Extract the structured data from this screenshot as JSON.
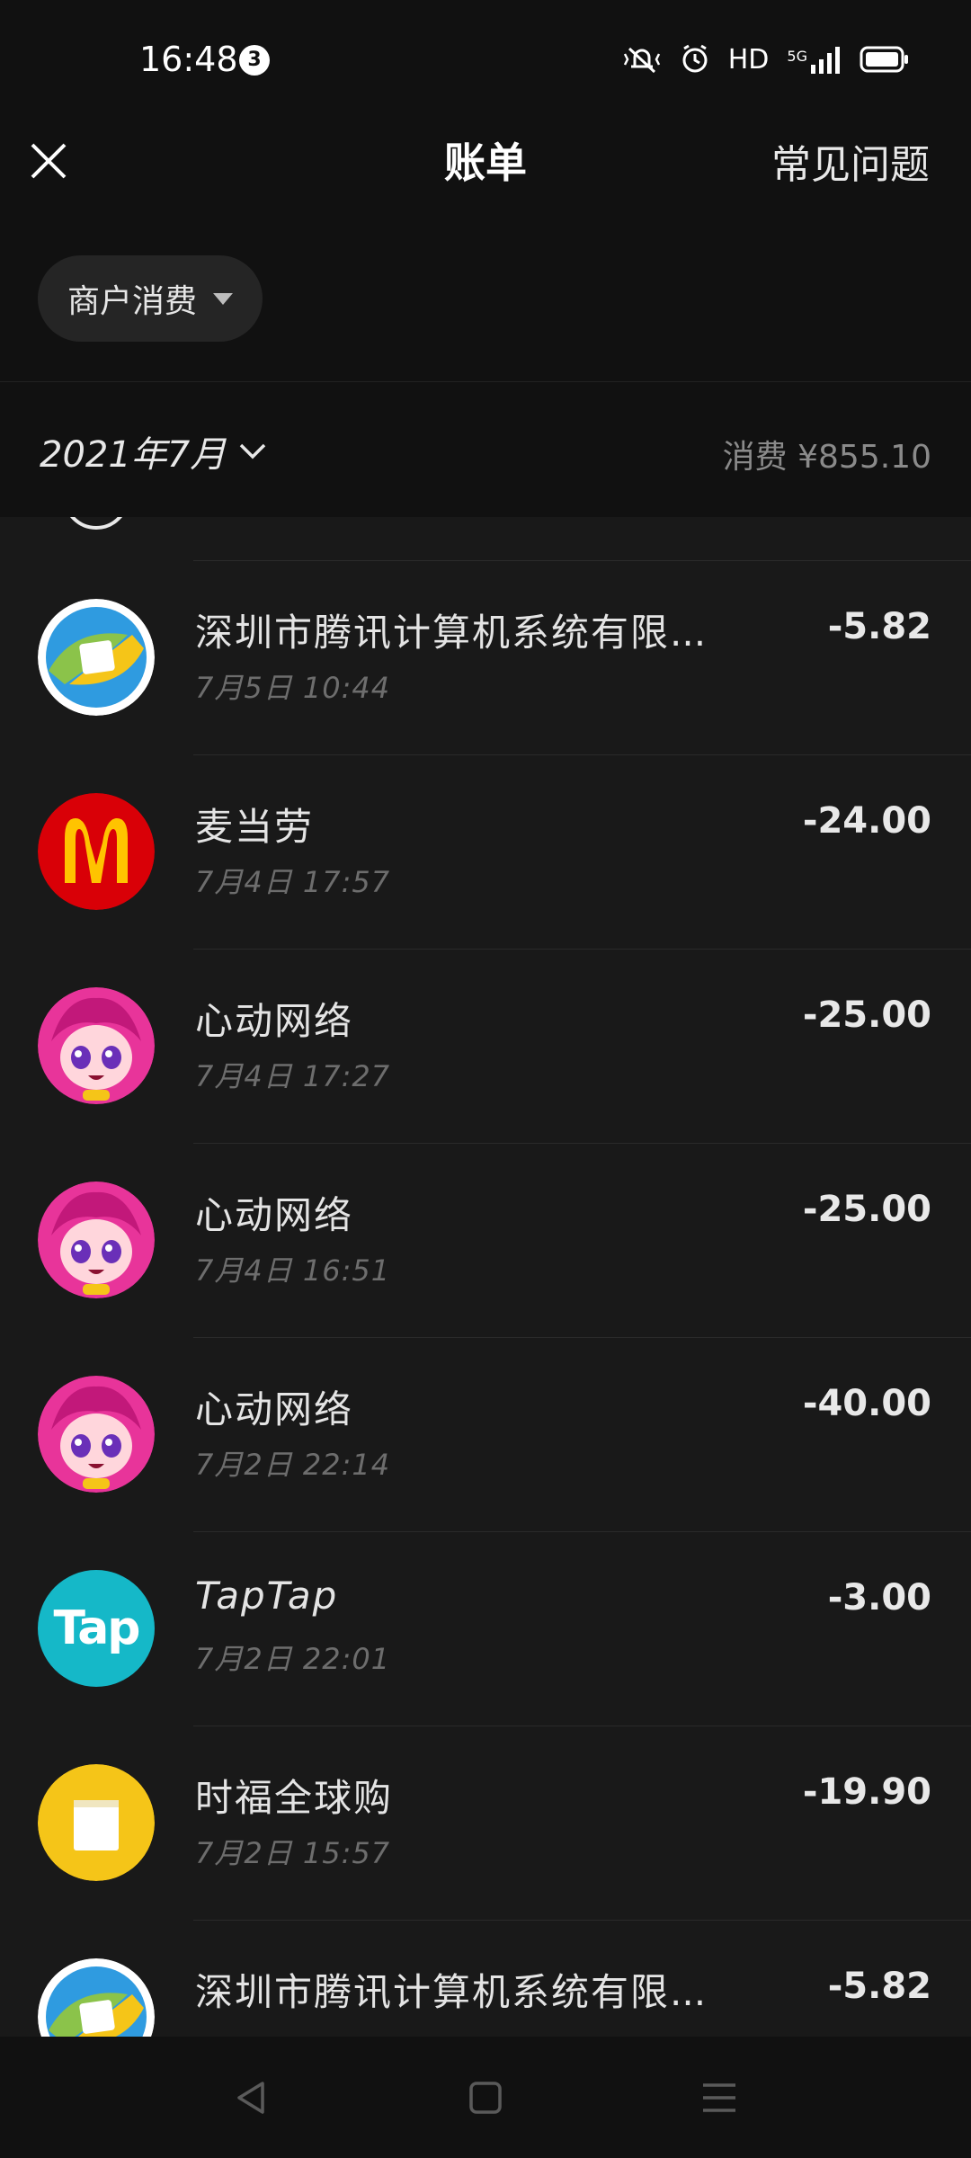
{
  "status_bar": {
    "time": "16:48",
    "notification_count": "3",
    "network_label": "HD",
    "network_type": "5G"
  },
  "header": {
    "title": "账单",
    "faq_label": "常见问题"
  },
  "filter": {
    "label": "商户消费"
  },
  "month": {
    "label": "2021年7月",
    "summary": "消费 ¥855.10"
  },
  "transactions": [
    {
      "merchant": "深圳市腾讯计算机系统有限",
      "time": "7月5日 10:44",
      "amount": "-5.82",
      "avatar_icon": "tencent-logo-icon",
      "avatar_color": "#ffffff"
    },
    {
      "merchant": "麦当劳",
      "time": "7月4日 17:57",
      "amount": "-24.00",
      "avatar_icon": "mcdonalds-logo-icon",
      "avatar_color": "#d90007"
    },
    {
      "merchant": "心动网络",
      "time": "7月4日 17:27",
      "amount": "-25.00",
      "avatar_icon": "xd-anime-avatar-icon",
      "avatar_color": "#e8349a"
    },
    {
      "merchant": "心动网络",
      "time": "7月4日 16:51",
      "amount": "-25.00",
      "avatar_icon": "xd-anime-avatar-icon",
      "avatar_color": "#e8349a"
    },
    {
      "merchant": "心动网络",
      "time": "7月2日 22:14",
      "amount": "-40.00",
      "avatar_icon": "xd-anime-avatar-icon",
      "avatar_color": "#e8349a"
    },
    {
      "merchant": "TapTap",
      "time": "7月2日 22:01",
      "amount": "-3.00",
      "avatar_icon": "taptap-logo-icon",
      "avatar_color": "#15b8c8",
      "logo_text": "Tap"
    },
    {
      "merchant": "时福全球购",
      "time": "7月2日 15:57",
      "amount": "-19.90",
      "avatar_icon": "shopping-bag-icon",
      "avatar_color": "#f5c518"
    },
    {
      "merchant": "深圳市腾讯计算机系统有限",
      "time": "",
      "amount": "-5.82",
      "avatar_icon": "tencent-logo-icon",
      "avatar_color": "#ffffff"
    }
  ]
}
